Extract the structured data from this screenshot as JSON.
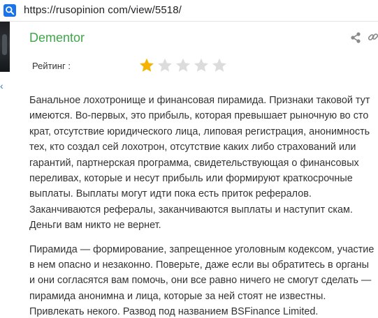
{
  "browser": {
    "url": "https://rusopinion com/view/5518/"
  },
  "review": {
    "author": "Dementor",
    "rating_label": "Рейтинг :",
    "rating": {
      "value": 1,
      "max": 5
    },
    "paragraphs": [
      "Банальное лохотронище и финансовая пирамида. Признаки таковой тут имеются. Во-первых, это прибыль, которая превышает рыночную во сто крат, отсутствие юридического лица, липовая регистрация, анонимность тех, кто создал сей лохотрон, отсутствие каких либо страхований или гарантий, партнерская программа, свидетельствующая о финансовых переливах, которые и несут прибыль или формируют краткосрочные выплаты. Выплаты могут идти пока есть приток рефералов. Заканчиваются рефералы, заканчиваются выплаты и наступит скам. Деньги вам никто не вернет.",
      "Пирамида — формирование, запрещенное уголовным кодексом, участие в нем опасно и незаконно. Поверьте, даже если вы обратитесь в органы и они согласятся вам помочь, они все равно ничего не смогут сделать — пирамида анонимна и лица, которые за ней стоят не известны. Привлекать некого. Развод под названием BSFinance Limited."
    ]
  },
  "colors": {
    "author": "#3fa64a",
    "star_filled": "#f5b301",
    "star_empty": "#dcdcdc",
    "link": "#2a7ab8"
  },
  "icons": {
    "search": "search-icon",
    "share": "share-icon",
    "link": "link-icon",
    "back": "chevron-left-icon",
    "star": "star-icon"
  }
}
